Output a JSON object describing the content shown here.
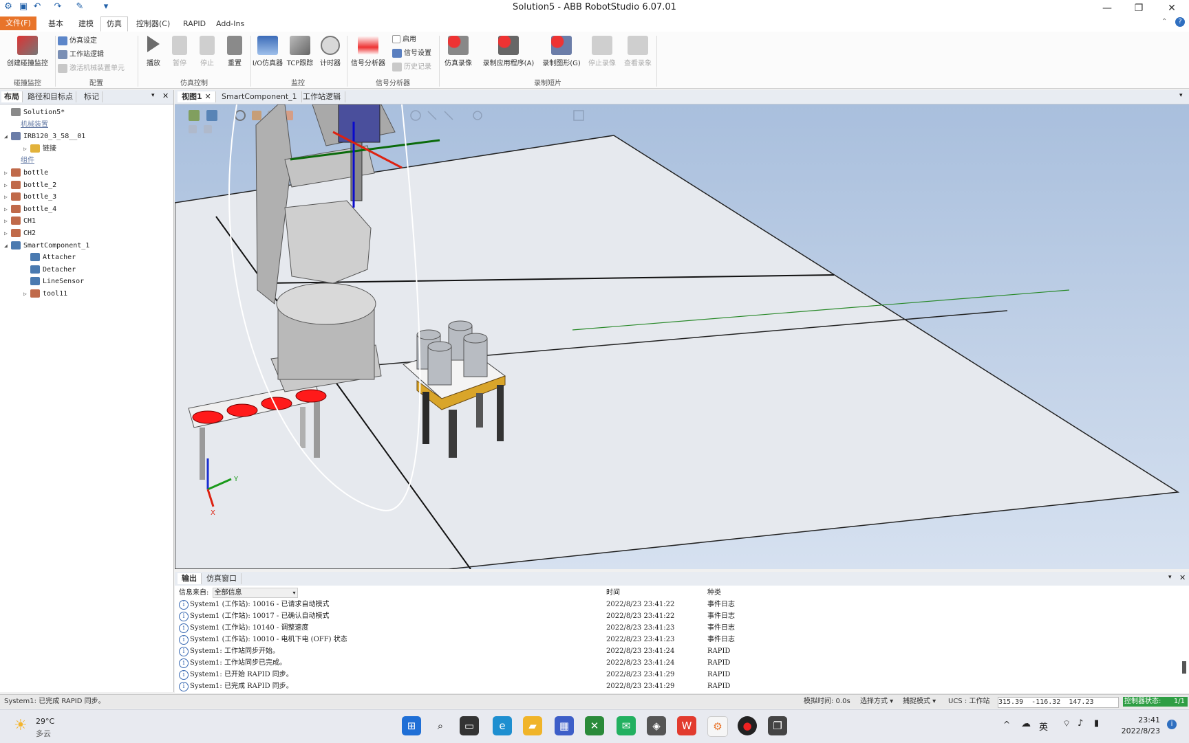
{
  "window": {
    "title": "Solution5 - ABB RobotStudio 6.07.01"
  },
  "ribbon_tabs": [
    "文件(F)",
    "基本",
    "建模",
    "仿真",
    "控制器(C)",
    "RAPID",
    "Add-Ins"
  ],
  "ribbon": {
    "create_collision": "创建碰撞监控",
    "sim_settings": "仿真设定",
    "station_logic": "工作站逻辑",
    "activate_mech": "激活机械装置单元",
    "play": "播放",
    "pause": "暂停",
    "stop": "停止",
    "reset": "重置",
    "io_sim": "I/O仿真器",
    "tcp_trace": "TCP跟踪",
    "timer": "计时器",
    "signal_analyzer": "信号分析器",
    "enable": "启用",
    "signal_settings": "信号设置",
    "history": "历史记录",
    "sim_record": "仿真录像",
    "record_app": "录制应用程序(A)",
    "record_graphics": "录制图形(G)",
    "stop_record": "停止录像",
    "view_record": "查看录象",
    "groups": {
      "collision": "碰撞监控",
      "config": "配置",
      "sim_control": "仿真控制",
      "monitor": "监控",
      "signal": "信号分析器",
      "record": "录制短片"
    }
  },
  "left_panel": {
    "tabs": [
      "布局",
      "路径和目标点",
      "标记"
    ],
    "tree": [
      {
        "label": "Solution5*",
        "indent": 0,
        "expander": "",
        "icon": "station"
      },
      {
        "label": "机械装置",
        "indent": 1,
        "expander": "",
        "icon": "",
        "link": true
      },
      {
        "label": "IRB120_3_58__01",
        "indent": 0,
        "expander": "◢",
        "icon": "robot"
      },
      {
        "label": "链接",
        "indent": 2,
        "expander": "▷",
        "icon": "folder"
      },
      {
        "label": "组件",
        "indent": 1,
        "expander": "",
        "icon": "",
        "link": true
      },
      {
        "label": "bottle",
        "indent": 0,
        "expander": "▷",
        "icon": "part"
      },
      {
        "label": "bottle_2",
        "indent": 0,
        "expander": "▷",
        "icon": "part"
      },
      {
        "label": "bottle_3",
        "indent": 0,
        "expander": "▷",
        "icon": "part"
      },
      {
        "label": "bottle_4",
        "indent": 0,
        "expander": "▷",
        "icon": "part"
      },
      {
        "label": "CH1",
        "indent": 0,
        "expander": "▷",
        "icon": "part"
      },
      {
        "label": "CH2",
        "indent": 0,
        "expander": "▷",
        "icon": "part"
      },
      {
        "label": "SmartComponent_1",
        "indent": 0,
        "expander": "◢",
        "icon": "smart"
      },
      {
        "label": "Attacher",
        "indent": 2,
        "expander": "",
        "icon": "smart"
      },
      {
        "label": "Detacher",
        "indent": 2,
        "expander": "",
        "icon": "smart"
      },
      {
        "label": "LineSensor",
        "indent": 2,
        "expander": "",
        "icon": "smart"
      },
      {
        "label": "tool11",
        "indent": 2,
        "expander": "▷",
        "icon": "part"
      }
    ]
  },
  "viewport_tabs": [
    "视图1",
    "SmartComponent_1",
    "工作站逻辑"
  ],
  "output": {
    "tabs": [
      "输出",
      "仿真窗口"
    ],
    "filter_label": "信息来自:",
    "filter_value": "全部信息",
    "col_time": "时间",
    "col_type": "种类",
    "rows": [
      {
        "msg": "System1 (工作站): 10016 - 已请求自动模式",
        "time": "2022/8/23 23:41:22",
        "type": "事件日志"
      },
      {
        "msg": "System1 (工作站): 10017 - 已确认自动模式",
        "time": "2022/8/23 23:41:22",
        "type": "事件日志"
      },
      {
        "msg": "System1 (工作站): 10140 - 调整速度",
        "time": "2022/8/23 23:41:23",
        "type": "事件日志"
      },
      {
        "msg": "System1 (工作站): 10010 - 电机下电 (OFF) 状态",
        "time": "2022/8/23 23:41:23",
        "type": "事件日志"
      },
      {
        "msg": "System1: 工作站同步开始。",
        "time": "2022/8/23 23:41:24",
        "type": "RAPID"
      },
      {
        "msg": "System1: 工作站同步已完成。",
        "time": "2022/8/23 23:41:24",
        "type": "RAPID"
      },
      {
        "msg": "System1: 已开始 RAPID 同步。",
        "time": "2022/8/23 23:41:29",
        "type": "RAPID"
      },
      {
        "msg": "System1: 已完成 RAPID 同步。",
        "time": "2022/8/23 23:41:29",
        "type": "RAPID"
      }
    ]
  },
  "status": {
    "message": "System1: 已完成 RAPID 同步。",
    "sim_time": "模拟时间: 0.0s",
    "select_mode": "选择方式",
    "snap_mode": "捕捉模式",
    "ucs": "UCS : 工作站",
    "coord_x": "315.39",
    "coord_y": "-116.32",
    "coord_z": "147.23",
    "controller_status": "控制器状态:",
    "controller_count": "1/1"
  },
  "taskbar": {
    "weather_temp": "29°C",
    "weather_desc": "多云",
    "ime": "英",
    "time": "23:41",
    "date": "2022/8/23"
  },
  "colors": {
    "file_tab": "#e8742a",
    "viewport_top": "#a9bfdd",
    "viewport_bottom": "#d6e1f0",
    "controller_ok": "#2f9e44",
    "bottle_red": "#ff1a1a"
  }
}
